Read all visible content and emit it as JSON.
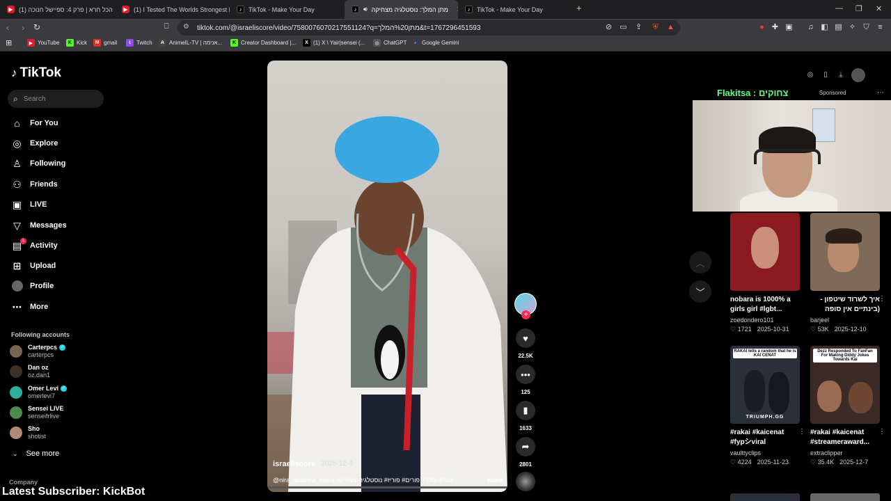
{
  "browser": {
    "tabs": [
      {
        "label": "(1) הכל חרא | פרק 4: ספיישל חנוכה",
        "type": "yt"
      },
      {
        "label": "(1) I Tested The Worlds Strongest Ene",
        "type": "yt"
      },
      {
        "label": "TikTok - Make Your Day",
        "type": "tt"
      },
      {
        "label": "מתן המלך: נוסטלגיה מצחיקה",
        "type": "tt",
        "active": true
      },
      {
        "label": "TikTok - Make Your Day",
        "type": "tt"
      }
    ],
    "new_tab": "+",
    "url": "tiktok.com/@israeliscore/video/7580076070217551124?q=מתן%20המלך&t=1767296451593",
    "bookmarks": [
      {
        "label": "YouTube",
        "color": "#e21b2c",
        "glyph": "▶"
      },
      {
        "label": "Kick",
        "color": "#53fc18",
        "glyph": "K"
      },
      {
        "label": "gmail",
        "color": "#d93025",
        "glyph": "M"
      },
      {
        "label": "Twitch",
        "color": "#9146ff",
        "glyph": "t"
      },
      {
        "label": "AnimeIL-TV | אנימה...",
        "color": "#444444",
        "glyph": "A"
      },
      {
        "label": "Creator Dashboard |...",
        "color": "#53fc18",
        "glyph": "K"
      },
      {
        "label": "(1) X \\ Yair|sensei (...",
        "color": "#000000",
        "glyph": "X"
      },
      {
        "label": "ChatGPT",
        "color": "#555555",
        "glyph": "◎"
      },
      {
        "label": "Google Gemini",
        "color": "#4285f4",
        "glyph": "✦"
      }
    ]
  },
  "sidebar": {
    "logo": "TikTok",
    "search_placeholder": "Search",
    "nav": [
      {
        "label": "For You",
        "icon": "home-icon",
        "glyph": "⌂"
      },
      {
        "label": "Explore",
        "icon": "compass-icon",
        "glyph": "◎"
      },
      {
        "label": "Following",
        "icon": "person-icon",
        "glyph": "♙"
      },
      {
        "label": "Friends",
        "icon": "friends-icon",
        "glyph": "⚇"
      },
      {
        "label": "LIVE",
        "icon": "live-icon",
        "glyph": "▣"
      },
      {
        "label": "Messages",
        "icon": "paper-plane-icon",
        "glyph": "▽"
      },
      {
        "label": "Activity",
        "icon": "bell-icon",
        "glyph": "▤"
      },
      {
        "label": "Upload",
        "icon": "plus-square-icon",
        "glyph": "⊞"
      },
      {
        "label": "Profile",
        "icon": "avatar-icon",
        "glyph": "●"
      },
      {
        "label": "More",
        "icon": "more-icon",
        "glyph": "⋯"
      }
    ],
    "activity_badge": "1",
    "following_title": "Following accounts",
    "accounts": [
      {
        "name": "Carterpcs",
        "user": "carterpcs",
        "verified": true
      },
      {
        "name": "Dan oz",
        "user": "oz.dan1",
        "verified": false
      },
      {
        "name": "Omer Levi",
        "user": "omerlevi7",
        "verified": true
      },
      {
        "name": "Sensei LIVE",
        "user": "senseifrlive",
        "verified": false
      },
      {
        "name": "Sho",
        "user": "shotist",
        "verified": false
      }
    ],
    "see_more": "See more",
    "company": "Company"
  },
  "stream_overlay": "Latest Subscriber: KickBot",
  "video": {
    "author": "israeliscore",
    "date": "2025-12-4",
    "caption": "@nira_tadanka_avera #מתןהמלך# פורים# פוריז# נוסטלגיה מצחיק# ...",
    "more": "more",
    "likes": "22.5K",
    "comments": "125",
    "saves": "1633",
    "shares": "2801"
  },
  "right_panel": {
    "sponsor_name": "Flakitsa : צחוקים",
    "sponsored": "Sponsored",
    "cards": [
      {
        "title": "nobara is 1000% a girls girl #lgbt...",
        "author": "zoedondero101",
        "likes": "1721",
        "date": "2025-10-31",
        "thumb": "#8a1a1f",
        "label": "",
        "foot": ""
      },
      {
        "title": "איך לשרוד שיטפון - (בינתיים אין סופה אין...",
        "author": "barjeel",
        "likes": "53K",
        "date": "2025-12-10",
        "thumb": "#7d6a58",
        "label": "",
        "foot": ""
      },
      {
        "title": "#rakai #kaicenat #fypシviral",
        "author": "vaulttyclips",
        "likes": "4224",
        "date": "2025-11-23",
        "thumb": "#2b2f3a",
        "label": "RAKAI tells a random that he is KAI CENAT",
        "foot": "TRIUMPH.GG"
      },
      {
        "title": "#rakai #kaicenat #streameraward...",
        "author": "extraclipper",
        "likes": "35.4K",
        "date": "2025-12-7",
        "thumb": "#3b2a26",
        "label": "Dezz Responded To FanFan For Making Diddy Jokes Towards Kai",
        "foot": ""
      }
    ]
  }
}
